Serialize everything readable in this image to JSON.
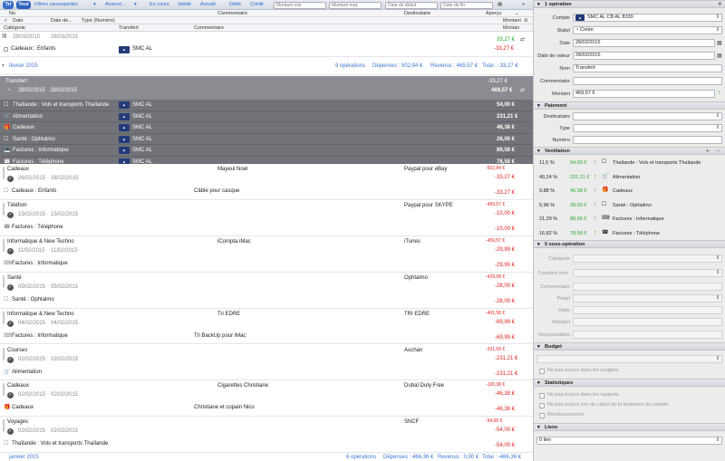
{
  "toolbar": {
    "tri": "Tri",
    "tout": "Tout",
    "filtres": "Filtres sauvegardés",
    "avance": "Avancé...",
    "en_cours": "En cours",
    "valide": "Validé",
    "annule": "Annulé",
    "debit": "Débit",
    "credit": "Crédit",
    "montant_min": "Montant min",
    "montant_max": "Montant max",
    "date_debut": "Date de début",
    "date_fin": "Date de fin"
  },
  "columns": {
    "row1": {
      "no": "No",
      "commentaire": "Commentaire",
      "destinataire": "Destinataire",
      "apercu": "Aperçu"
    },
    "row2": {
      "date": "Date",
      "date_de": "Date de...",
      "type": "Type (Numéro)",
      "montant": "Montant"
    },
    "row3": {
      "categorie": "Catégorie",
      "transfert": "Transfert",
      "commentaire": "Commentaire",
      "montan": "Montan"
    }
  },
  "top_row": {
    "date1": "28/03/2015",
    "date2": "28/03/2015",
    "amount": "33,27 €",
    "category": "Cadeaux : Enfants",
    "bank": "SMC AL",
    "amount2": "-33,27 €"
  },
  "month_group": {
    "label": "février 2015",
    "count": "9 opérations",
    "depenses": "Dépenses : 502,84 €",
    "revenus": "Revenus : 469,57 €",
    "total": "Total : -33,27 €"
  },
  "transfer": {
    "title": "Transfert",
    "amount_neg": "-33,27 €",
    "date1": "28/02/2015",
    "date2": "28/02/2015",
    "amount": "469,57 €",
    "splits": [
      {
        "category": "Thaïlande : Vols et transports Thaïlande",
        "bank": "SMC AL",
        "amount": "54,00 €"
      },
      {
        "category": "Alimentation",
        "bank": "SMC AL",
        "amount": "231,21 €"
      },
      {
        "category": "Cadeaux",
        "bank": "SMC AL",
        "amount": "46,38 €"
      },
      {
        "category": "Santé : Ophtalmo",
        "bank": "SMC AL",
        "amount": "28,00 €"
      },
      {
        "category": "Factures : Informatique",
        "bank": "SMC AL",
        "amount": "89,58 €"
      },
      {
        "category": "Factures : Téléphone",
        "bank": "SMC AL",
        "amount": "78,58 €"
      }
    ]
  },
  "transactions": [
    {
      "name": "Cadeaux",
      "d1": "26/02/2015",
      "d2": "28/02/2015",
      "comment": "Mayeul Noel",
      "dest": "Paypal pour eBay",
      "bal": "-502,84 €",
      "amount": "-33,27 €",
      "cat": "Cadeaux : Enfants",
      "note": "Câble pour casque",
      "amount2": "-33,27 €"
    },
    {
      "name": "Téléfom",
      "d1": "15/02/2015",
      "d2": "15/02/2015",
      "comment": "",
      "dest": "Paypal pour SKYPE",
      "bal": "-469,57 €",
      "amount": "-10,00 €",
      "cat": "Factures : Téléphone",
      "note": "",
      "amount2": "-10,00 €"
    },
    {
      "name": "Informatique & New Techno",
      "d1": "11/02/2015",
      "d2": "11/02/2015",
      "comment": "iCompta iMac",
      "dest": "iTunes",
      "bal": "-459,57 €",
      "amount": "-29,99 €",
      "cat": "Factures : Informatique",
      "note": "",
      "amount2": "-29,99 €"
    },
    {
      "name": "Santé",
      "d1": "05/02/2015",
      "d2": "05/02/2015",
      "comment": "",
      "dest": "Ophtalmo",
      "bal": "-429,58 €",
      "amount": "-28,00 €",
      "cat": "Santé : Ophtalmo",
      "note": "",
      "amount2": "-28,00 €"
    },
    {
      "name": "Informatique & New Techno",
      "d1": "04/02/2015",
      "d2": "04/02/2015",
      "comment": "Tri EDRE",
      "dest": "TRI EDRE",
      "bal": "-401,58 €",
      "amount": "-69,99 €",
      "cat": "Factures : Informatique",
      "note": "Tri BackUp pour iMac",
      "amount2": "-69,99 €"
    },
    {
      "name": "Courses",
      "d1": "02/02/2015",
      "d2": "02/02/2015",
      "comment": "",
      "dest": "Auchan",
      "bal": "-331,59 €",
      "amount": "-231,21 €",
      "cat": "Alimentation",
      "note": "",
      "amount2": "-231,21 €"
    },
    {
      "name": "Cadeaux",
      "d1": "02/02/2015",
      "d2": "02/02/2015",
      "comment": "Cigarettes Christiane",
      "dest": "Dubaï Duty Free",
      "bal": "-100,38 €",
      "amount": "-46,38 €",
      "cat": "Cadeaux",
      "note": "Christiane et copain Nico",
      "amount2": "-46,38 €"
    },
    {
      "name": "Voyages",
      "d1": "02/02/2015",
      "d2": "02/02/2015",
      "comment": "",
      "dest": "SNCF",
      "bal": "-54,00 €",
      "amount": "-54,00 €",
      "cat": "Thaïlande : Vols et transports Thaïlande",
      "note": "",
      "amount2": "-54,00 €"
    }
  ],
  "next_group": {
    "label": "janvier 2015",
    "count": "6 opérations",
    "depenses": "Dépenses : 466,36 €",
    "revenus": "Revenus : 0,00 €",
    "total": "Total : -466,36 €"
  },
  "panel": {
    "op_header": "1 opération",
    "compte_label": "Compte",
    "compte_value": "SMC AL CB AL 8339",
    "statut_label": "Statut",
    "statut_value": "Créée",
    "date_label": "Date",
    "date_value": "28/02/2015",
    "date_valeur_label": "Date de valeur",
    "date_valeur_value": "28/02/2015",
    "nom_label": "Nom",
    "nom_value": "Transfert",
    "commentaire_label": "Commentaire",
    "commentaire_value": "",
    "montant_label": "Montant",
    "montant_value": "469,57 €",
    "paiement_header": "Paiement",
    "destinataire_label": "Destinataire",
    "type_label": "Type",
    "numero_label": "Numéro",
    "ventilation_header": "Ventilation",
    "ventilation": [
      {
        "pct": "11,5 %",
        "amount": "54,00 €",
        "label": "Thaïlande : Vols et transports Thaïlande"
      },
      {
        "pct": "49,24 %",
        "amount": "231,21 €",
        "label": "Alimentation"
      },
      {
        "pct": "9,88 %",
        "amount": "46,38 €",
        "label": "Cadeaux"
      },
      {
        "pct": "5,96 %",
        "amount": "28,00 €",
        "label": "Santé : Ophtalmo"
      },
      {
        "pct": "21,29 %",
        "amount": "89,58 €",
        "label": "Factures : Informatique"
      },
      {
        "pct": "16,82 %",
        "amount": "78,58 €",
        "label": "Factures : Téléphone"
      }
    ],
    "sous_op_header": "0 sous-opération",
    "categorie_label": "Catégorie",
    "transfert_vers_label": "Transfert vers",
    "commentaire2_label": "Commentaire",
    "projet_label": "Projet",
    "ratio_label": "Ratio",
    "montant2_label": "Montant",
    "responsables_label": "Responsables",
    "budget_header": "Budget",
    "budget_check": "Ne pas inclure dans les budgets",
    "stats_header": "Statistiques",
    "stats_check1": "Ne pas inclure dans les rapports",
    "stats_check2": "Ne pas inclure lors du calcul de la tendance du compte",
    "stats_check3": "Remboursement",
    "liens_header": "Liens",
    "liens_value": "0 lien"
  },
  "colors": {
    "accent": "#3b6fc9",
    "negative": "#e12020",
    "positive": "#22a82a",
    "group_dark": "#717378"
  }
}
